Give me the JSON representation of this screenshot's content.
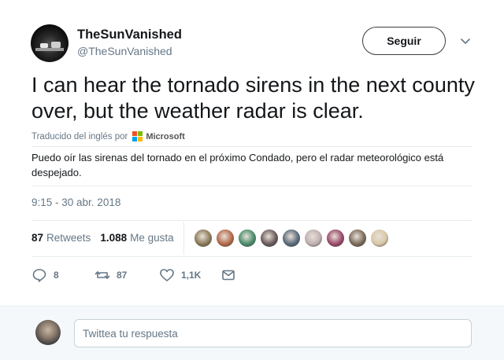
{
  "user": {
    "display_name": "TheSunVanished",
    "handle": "@TheSunVanished"
  },
  "follow_button": {
    "label": "Seguir"
  },
  "tweet": {
    "text": "I can hear the tornado sirens in the next county over, but the weather radar is clear.",
    "translated_by_label": "Traducido del inglés por",
    "translator_name": "Microsoft",
    "translation": "Puedo oír las sirenas del tornado en el próximo Condado, pero el radar meteorológico está despejado.",
    "timestamp": "9:15 - 30 abr. 2018"
  },
  "stats": {
    "retweets_count": "87",
    "retweets_label": "Retweets",
    "likes_count": "1.088",
    "likes_label": "Me gusta"
  },
  "likers": [
    {
      "color": "#8c7a5a"
    },
    {
      "color": "#b46a4a"
    },
    {
      "color": "#4a8c6a"
    },
    {
      "color": "#6a5a5a"
    },
    {
      "color": "#5a6a7a"
    },
    {
      "color": "#c0b0b0"
    },
    {
      "color": "#9a4a6a"
    },
    {
      "color": "#7a6a5a"
    },
    {
      "color": "#d8c8a8"
    }
  ],
  "actions": {
    "reply_count": "8",
    "retweet_count": "87",
    "like_count": "1,1K"
  },
  "reply": {
    "placeholder": "Twittea tu respuesta"
  },
  "colors": {
    "ms_red": "#f25022",
    "ms_green": "#7fba00",
    "ms_blue": "#00a4ef",
    "ms_yellow": "#ffb900",
    "action_gray": "#657786"
  }
}
